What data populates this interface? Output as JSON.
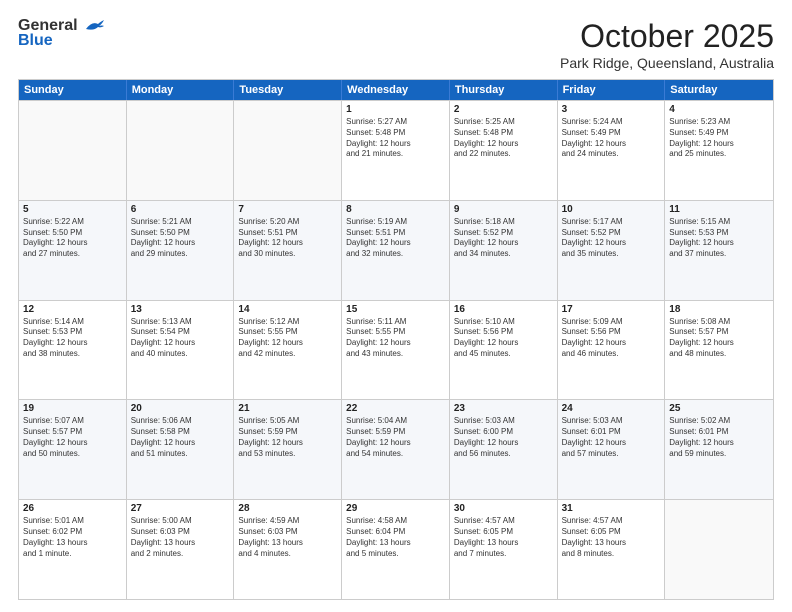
{
  "header": {
    "logo_general": "General",
    "logo_blue": "Blue",
    "month_title": "October 2025",
    "location": "Park Ridge, Queensland, Australia"
  },
  "weekdays": [
    "Sunday",
    "Monday",
    "Tuesday",
    "Wednesday",
    "Thursday",
    "Friday",
    "Saturday"
  ],
  "rows": [
    [
      {
        "day": "",
        "info": ""
      },
      {
        "day": "",
        "info": ""
      },
      {
        "day": "",
        "info": ""
      },
      {
        "day": "1",
        "info": "Sunrise: 5:27 AM\nSunset: 5:48 PM\nDaylight: 12 hours\nand 21 minutes."
      },
      {
        "day": "2",
        "info": "Sunrise: 5:25 AM\nSunset: 5:48 PM\nDaylight: 12 hours\nand 22 minutes."
      },
      {
        "day": "3",
        "info": "Sunrise: 5:24 AM\nSunset: 5:49 PM\nDaylight: 12 hours\nand 24 minutes."
      },
      {
        "day": "4",
        "info": "Sunrise: 5:23 AM\nSunset: 5:49 PM\nDaylight: 12 hours\nand 25 minutes."
      }
    ],
    [
      {
        "day": "5",
        "info": "Sunrise: 5:22 AM\nSunset: 5:50 PM\nDaylight: 12 hours\nand 27 minutes."
      },
      {
        "day": "6",
        "info": "Sunrise: 5:21 AM\nSunset: 5:50 PM\nDaylight: 12 hours\nand 29 minutes."
      },
      {
        "day": "7",
        "info": "Sunrise: 5:20 AM\nSunset: 5:51 PM\nDaylight: 12 hours\nand 30 minutes."
      },
      {
        "day": "8",
        "info": "Sunrise: 5:19 AM\nSunset: 5:51 PM\nDaylight: 12 hours\nand 32 minutes."
      },
      {
        "day": "9",
        "info": "Sunrise: 5:18 AM\nSunset: 5:52 PM\nDaylight: 12 hours\nand 34 minutes."
      },
      {
        "day": "10",
        "info": "Sunrise: 5:17 AM\nSunset: 5:52 PM\nDaylight: 12 hours\nand 35 minutes."
      },
      {
        "day": "11",
        "info": "Sunrise: 5:15 AM\nSunset: 5:53 PM\nDaylight: 12 hours\nand 37 minutes."
      }
    ],
    [
      {
        "day": "12",
        "info": "Sunrise: 5:14 AM\nSunset: 5:53 PM\nDaylight: 12 hours\nand 38 minutes."
      },
      {
        "day": "13",
        "info": "Sunrise: 5:13 AM\nSunset: 5:54 PM\nDaylight: 12 hours\nand 40 minutes."
      },
      {
        "day": "14",
        "info": "Sunrise: 5:12 AM\nSunset: 5:55 PM\nDaylight: 12 hours\nand 42 minutes."
      },
      {
        "day": "15",
        "info": "Sunrise: 5:11 AM\nSunset: 5:55 PM\nDaylight: 12 hours\nand 43 minutes."
      },
      {
        "day": "16",
        "info": "Sunrise: 5:10 AM\nSunset: 5:56 PM\nDaylight: 12 hours\nand 45 minutes."
      },
      {
        "day": "17",
        "info": "Sunrise: 5:09 AM\nSunset: 5:56 PM\nDaylight: 12 hours\nand 46 minutes."
      },
      {
        "day": "18",
        "info": "Sunrise: 5:08 AM\nSunset: 5:57 PM\nDaylight: 12 hours\nand 48 minutes."
      }
    ],
    [
      {
        "day": "19",
        "info": "Sunrise: 5:07 AM\nSunset: 5:57 PM\nDaylight: 12 hours\nand 50 minutes."
      },
      {
        "day": "20",
        "info": "Sunrise: 5:06 AM\nSunset: 5:58 PM\nDaylight: 12 hours\nand 51 minutes."
      },
      {
        "day": "21",
        "info": "Sunrise: 5:05 AM\nSunset: 5:59 PM\nDaylight: 12 hours\nand 53 minutes."
      },
      {
        "day": "22",
        "info": "Sunrise: 5:04 AM\nSunset: 5:59 PM\nDaylight: 12 hours\nand 54 minutes."
      },
      {
        "day": "23",
        "info": "Sunrise: 5:03 AM\nSunset: 6:00 PM\nDaylight: 12 hours\nand 56 minutes."
      },
      {
        "day": "24",
        "info": "Sunrise: 5:03 AM\nSunset: 6:01 PM\nDaylight: 12 hours\nand 57 minutes."
      },
      {
        "day": "25",
        "info": "Sunrise: 5:02 AM\nSunset: 6:01 PM\nDaylight: 12 hours\nand 59 minutes."
      }
    ],
    [
      {
        "day": "26",
        "info": "Sunrise: 5:01 AM\nSunset: 6:02 PM\nDaylight: 13 hours\nand 1 minute."
      },
      {
        "day": "27",
        "info": "Sunrise: 5:00 AM\nSunset: 6:03 PM\nDaylight: 13 hours\nand 2 minutes."
      },
      {
        "day": "28",
        "info": "Sunrise: 4:59 AM\nSunset: 6:03 PM\nDaylight: 13 hours\nand 4 minutes."
      },
      {
        "day": "29",
        "info": "Sunrise: 4:58 AM\nSunset: 6:04 PM\nDaylight: 13 hours\nand 5 minutes."
      },
      {
        "day": "30",
        "info": "Sunrise: 4:57 AM\nSunset: 6:05 PM\nDaylight: 13 hours\nand 7 minutes."
      },
      {
        "day": "31",
        "info": "Sunrise: 4:57 AM\nSunset: 6:05 PM\nDaylight: 13 hours\nand 8 minutes."
      },
      {
        "day": "",
        "info": ""
      }
    ]
  ]
}
